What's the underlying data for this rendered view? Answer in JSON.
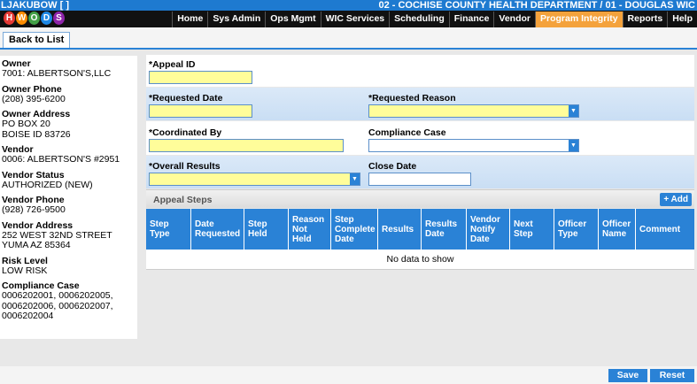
{
  "header": {
    "user": "LJAKUBOW [        ]",
    "agency": "02 - COCHISE COUNTY HEALTH DEPARTMENT / 01 - DOUGLAS WIC"
  },
  "logo": {
    "letters": [
      "H",
      "W",
      "O",
      "D",
      "S"
    ]
  },
  "nav": {
    "tabs": [
      "Home",
      "Sys Admin",
      "Ops Mgmt",
      "WIC Services",
      "Scheduling",
      "Finance",
      "Vendor",
      "Program Integrity",
      "Reports",
      "Help"
    ],
    "active": "Program Integrity"
  },
  "back_button": "Back to List",
  "vendor_info": [
    {
      "label": "Owner",
      "value": "7001: ALBERTSON'S,LLC"
    },
    {
      "label": "Owner Phone",
      "value": "(208) 395-6200"
    },
    {
      "label": "Owner Address",
      "value": "PO BOX 20\nBOISE ID 83726"
    },
    {
      "label": "Vendor",
      "value": "0006: ALBERTSON'S #2951"
    },
    {
      "label": "Vendor Status",
      "value": "AUTHORIZED (NEW)"
    },
    {
      "label": "Vendor Phone",
      "value": "(928) 726-9500"
    },
    {
      "label": "Vendor Address",
      "value": "252 WEST 32ND STREET\nYUMA AZ 85364"
    },
    {
      "label": "Risk Level",
      "value": "LOW RISK"
    },
    {
      "label": "Compliance Case",
      "value": "0006202001, 0006202005,\n0006202006, 0006202007,\n0006202004"
    }
  ],
  "form": {
    "appeal_id": {
      "label": "*Appeal ID",
      "value": ""
    },
    "requested_date": {
      "label": "*Requested Date",
      "value": ""
    },
    "requested_reason": {
      "label": "*Requested Reason",
      "value": ""
    },
    "coordinated_by": {
      "label": "*Coordinated By",
      "value": ""
    },
    "compliance_case": {
      "label": "Compliance Case",
      "value": ""
    },
    "overall_results": {
      "label": "*Overall Results",
      "value": ""
    },
    "close_date": {
      "label": "Close Date",
      "value": ""
    }
  },
  "appeal_steps": {
    "title": "Appeal Steps",
    "add_label": "+ Add",
    "columns": [
      "Step Type",
      "Date Requested",
      "Step Held",
      "Reason Not Held",
      "Step Complete Date",
      "Results",
      "Results Date",
      "Vendor Notify Date",
      "Next Step",
      "Officer Type",
      "Officer Name",
      "Comment"
    ],
    "empty_text": "No data to show"
  },
  "footer": {
    "save": "Save",
    "reset": "Reset"
  },
  "colors": {
    "accent": "#2a82d6",
    "active_tab": "#f4a23c",
    "required_field": "#fffd9a"
  }
}
